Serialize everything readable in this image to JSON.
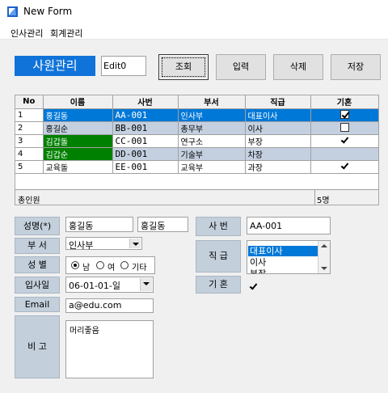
{
  "window": {
    "title": "New Form"
  },
  "menu": {
    "items": [
      "인사관리",
      "회계관리"
    ]
  },
  "toolbar": {
    "heading": "사원관리",
    "edit_value": "Edit0",
    "buttons": [
      "조회",
      "입력",
      "삭제",
      "저장"
    ]
  },
  "colors": {
    "accent": "#0f73d9",
    "selection": "#0078d7",
    "alt_row": "#c4d0e0",
    "highlight_cell": "#008000",
    "label_bg": "#c3cfdb"
  },
  "grid": {
    "columns": [
      "No",
      "이름",
      "사번",
      "부서",
      "직급",
      "기혼"
    ],
    "rows": [
      {
        "no": "1",
        "name": "홍길동",
        "id": "AA-001",
        "dept": "인사부",
        "rank": "대표이사",
        "married": true
      },
      {
        "no": "2",
        "name": "홍길순",
        "id": "BB-001",
        "dept": "총무부",
        "rank": "이사",
        "married": false
      },
      {
        "no": "3",
        "name": "김갑돌",
        "id": "CC-001",
        "dept": "연구소",
        "rank": "부장",
        "married": true
      },
      {
        "no": "4",
        "name": "김갑순",
        "id": "DD-001",
        "dept": "기술부",
        "rank": "차장",
        "married": false
      },
      {
        "no": "5",
        "name": "교육돌",
        "id": "EE-001",
        "dept": "교육부",
        "rank": "과장",
        "married": true
      }
    ],
    "footer_caption": "총인원",
    "footer_count": "5명"
  },
  "form": {
    "name_label": "성명(*)",
    "name_value": "홍길동",
    "name_value2": "홍길동",
    "dept_label": "부 서",
    "dept_value": "인사부",
    "gender_label": "성 별",
    "gender_options": [
      "남",
      "여",
      "기타"
    ],
    "gender_selected": "남",
    "join_label": "입사일",
    "join_value": "06-01-01-일",
    "email_label": "Email",
    "email_value": "a@edu.com",
    "memo_label": "비 고",
    "memo_value": "머리좋음",
    "id_label": "사 번",
    "id_value": "AA-001",
    "rank_label": "직 급",
    "rank_options": [
      "대표이사",
      "이사",
      "부장"
    ],
    "rank_selected": "대표이사",
    "married_label": "기 혼",
    "married_value": true
  }
}
